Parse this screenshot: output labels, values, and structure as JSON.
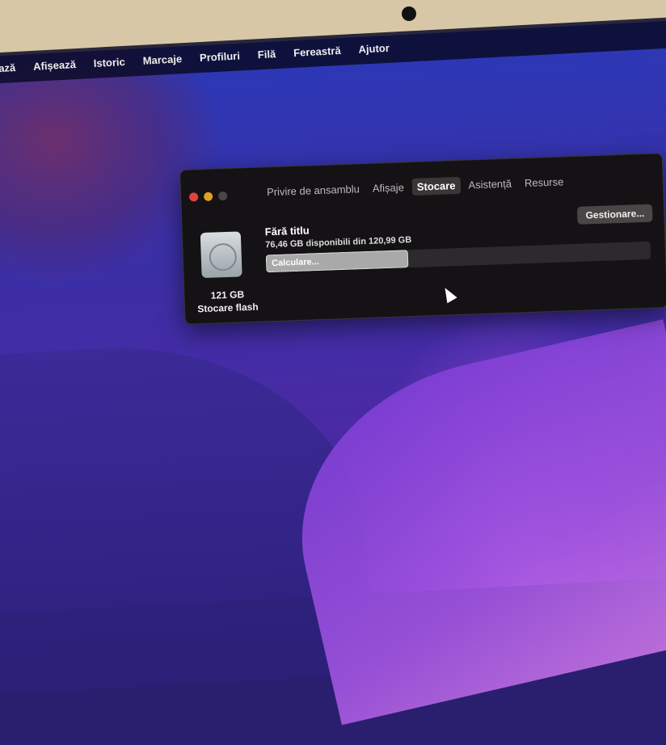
{
  "menubar": {
    "items": [
      "ează",
      "Afișează",
      "Istoric",
      "Marcaje",
      "Profiluri",
      "Filă",
      "Fereastră",
      "Ajutor"
    ]
  },
  "window": {
    "tabs": [
      {
        "label": "Privire de ansamblu"
      },
      {
        "label": "Afișaje"
      },
      {
        "label": "Stocare",
        "active": true
      },
      {
        "label": "Asistență"
      },
      {
        "label": "Resurse"
      }
    ],
    "disk": {
      "size": "121 GB",
      "type": "Stocare flash"
    },
    "volume": {
      "name": "Fără titlu",
      "available": "76,46 GB disponibili din 120,99 GB",
      "status": "Calculare...",
      "used_fraction": 0.37
    },
    "manage_label": "Gestionare..."
  },
  "colors": {
    "close": "#e0443e",
    "minimize": "#dea123",
    "zoom": "#4a4646"
  }
}
